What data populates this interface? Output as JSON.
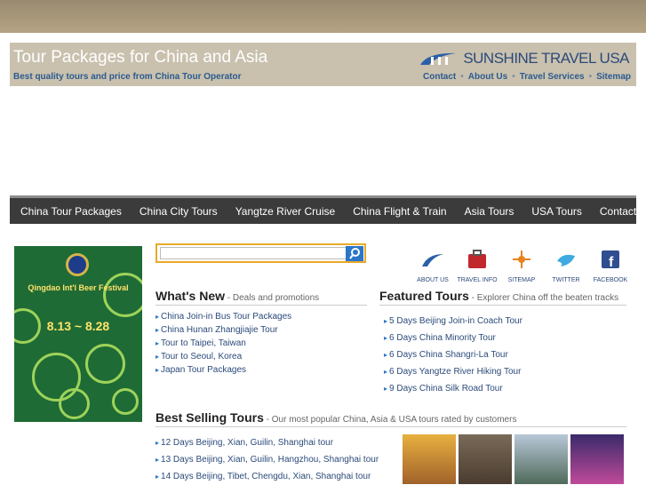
{
  "header": {
    "title": "Tour Packages for China and Asia",
    "subtitle": "Best quality tours and price from China Tour Operator",
    "brand": "SUNSHINE TRAVEL USA",
    "links": [
      "Contact",
      "About Us",
      "Travel Services",
      "Sitemap"
    ]
  },
  "nav": [
    "China Tour Packages",
    "China City Tours",
    "Yangtze River Cruise",
    "China Flight & Train",
    "Asia Tours",
    "USA Tours",
    "Contact Us"
  ],
  "banner": {
    "title": "Qingdao Int'l Beer Festival",
    "dates": "8.13 ~ 8.28"
  },
  "search": {
    "placeholder": ""
  },
  "social": [
    "ABOUT US",
    "TRAVEL INFO",
    "SITEMAP",
    "TWITTER",
    "FACEBOOK"
  ],
  "whats_new": {
    "title": "What's New",
    "desc": " - Deals and promotions",
    "items": [
      "China Join-in Bus Tour Packages",
      "China Hunan Zhangjiajie Tour",
      "Tour to Taipei, Taiwan",
      "Tour to Seoul, Korea",
      "Japan Tour Packages"
    ]
  },
  "featured": {
    "title": "Featured Tours",
    "desc": " - Explorer China off the beaten tracks",
    "items": [
      "5 Days Beijing Join-in Coach Tour",
      "6 Days China Minority Tour",
      "6 Days China Shangri-La Tour",
      "6 Days Yangtze River Hiking Tour",
      "9 Days China Silk Road Tour"
    ]
  },
  "best_selling": {
    "title": "Best Selling Tours",
    "desc": " - Our most popular China, Asia & USA tours rated by customers",
    "items": [
      "12 Days Beijing, Xian, Guilin, Shanghai tour",
      "13 Days Beijing, Xian, Guilin, Hangzhou, Shanghai tour",
      "14 Days Beijing, Tibet, Chengdu, Xian, Shanghai tour"
    ]
  },
  "colors": {
    "nav_bg": "#3b3b3b",
    "header_bg": "#c9c1ae",
    "link": "#2b4a7a",
    "accent": "#2b76c8"
  }
}
